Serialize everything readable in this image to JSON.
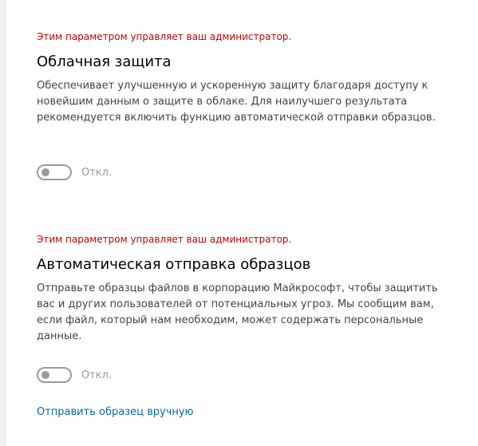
{
  "cloud_protection": {
    "admin_note": "Этим параметром управляет ваш администратор.",
    "title": "Облачная защита",
    "description": "Обеспечивает улучшенную и ускоренную защиту благодаря доступу к новейшим данным о защите в облаке. Для наилучшего результата рекомендуется включить функцию автоматической отправки образцов.",
    "toggle_state": "Откл."
  },
  "sample_submission": {
    "admin_note": "Этим параметром управляет ваш администратор.",
    "title": "Автоматическая отправка образцов",
    "description": "Отправьте образцы файлов в корпорацию Майкрософт, чтобы защитить вас и других пользователей от потенциальных угроз. Мы сообщим вам, если файл, который нам необходим, может содержать персональные данные.",
    "toggle_state": "Откл.",
    "manual_link": "Отправить образец вручную"
  },
  "colors": {
    "admin_note": "#c50000",
    "link": "#0067b8",
    "toggle_off": "#9a9a9a"
  }
}
